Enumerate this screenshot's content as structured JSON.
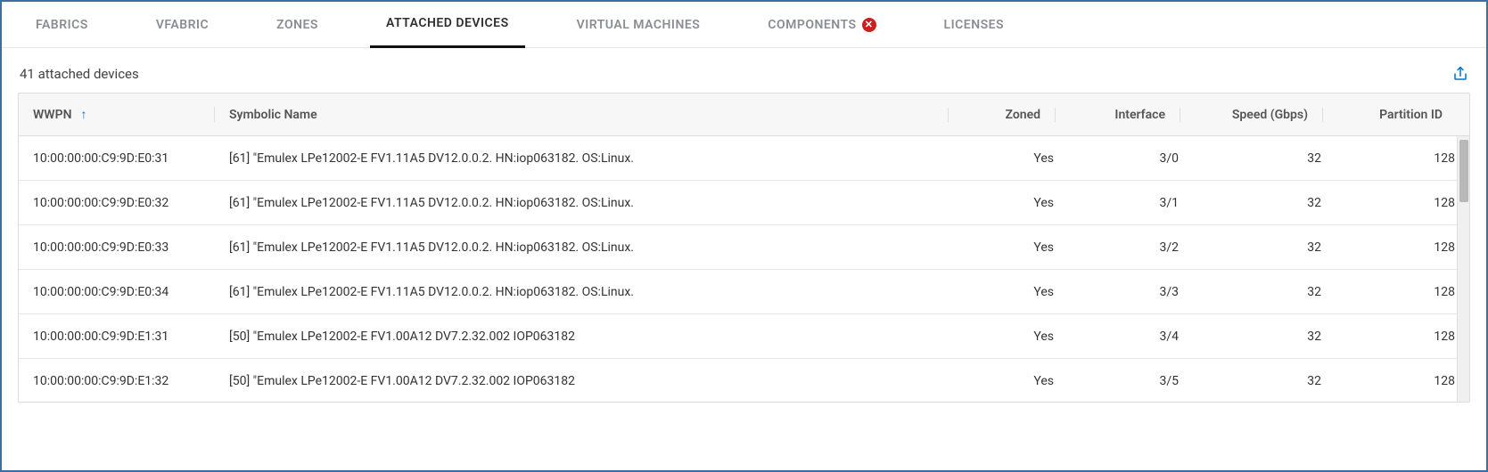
{
  "tabs": [
    {
      "label": "FABRICS",
      "active": false,
      "error": false
    },
    {
      "label": "VFABRIC",
      "active": false,
      "error": false
    },
    {
      "label": "ZONES",
      "active": false,
      "error": false
    },
    {
      "label": "ATTACHED DEVICES",
      "active": true,
      "error": false
    },
    {
      "label": "VIRTUAL MACHINES",
      "active": false,
      "error": false
    },
    {
      "label": "COMPONENTS",
      "active": false,
      "error": true
    },
    {
      "label": "LICENSES",
      "active": false,
      "error": false
    }
  ],
  "summary": "41 attached devices",
  "columns": {
    "wwpn": "WWPN",
    "name": "Symbolic Name",
    "zoned": "Zoned",
    "iface": "Interface",
    "speed": "Speed (Gbps)",
    "pid": "Partition ID"
  },
  "sort": {
    "column": "wwpn",
    "dir": "asc"
  },
  "rows": [
    {
      "wwpn": "10:00:00:00:C9:9D:E0:31",
      "name": "[61] \"Emulex LPe12002-E FV1.11A5 DV12.0.0.2. HN:iop063182. OS:Linux.",
      "zoned": "Yes",
      "iface": "3/0",
      "speed": "32",
      "pid": "128"
    },
    {
      "wwpn": "10:00:00:00:C9:9D:E0:32",
      "name": "[61] \"Emulex LPe12002-E FV1.11A5 DV12.0.0.2. HN:iop063182. OS:Linux.",
      "zoned": "Yes",
      "iface": "3/1",
      "speed": "32",
      "pid": "128"
    },
    {
      "wwpn": "10:00:00:00:C9:9D:E0:33",
      "name": "[61] \"Emulex LPe12002-E FV1.11A5 DV12.0.0.2. HN:iop063182. OS:Linux.",
      "zoned": "Yes",
      "iface": "3/2",
      "speed": "32",
      "pid": "128"
    },
    {
      "wwpn": "10:00:00:00:C9:9D:E0:34",
      "name": "[61] \"Emulex LPe12002-E FV1.11A5 DV12.0.0.2. HN:iop063182. OS:Linux.",
      "zoned": "Yes",
      "iface": "3/3",
      "speed": "32",
      "pid": "128"
    },
    {
      "wwpn": "10:00:00:00:C9:9D:E1:31",
      "name": "[50] \"Emulex LPe12002-E FV1.00A12 DV7.2.32.002 IOP063182",
      "zoned": "Yes",
      "iface": "3/4",
      "speed": "32",
      "pid": "128"
    },
    {
      "wwpn": "10:00:00:00:C9:9D:E1:32",
      "name": "[50] \"Emulex LPe12002-E FV1.00A12 DV7.2.32.002 IOP063182",
      "zoned": "Yes",
      "iface": "3/5",
      "speed": "32",
      "pid": "128"
    }
  ],
  "icons": {
    "error_glyph": "✕",
    "sort_asc_glyph": "↑"
  }
}
